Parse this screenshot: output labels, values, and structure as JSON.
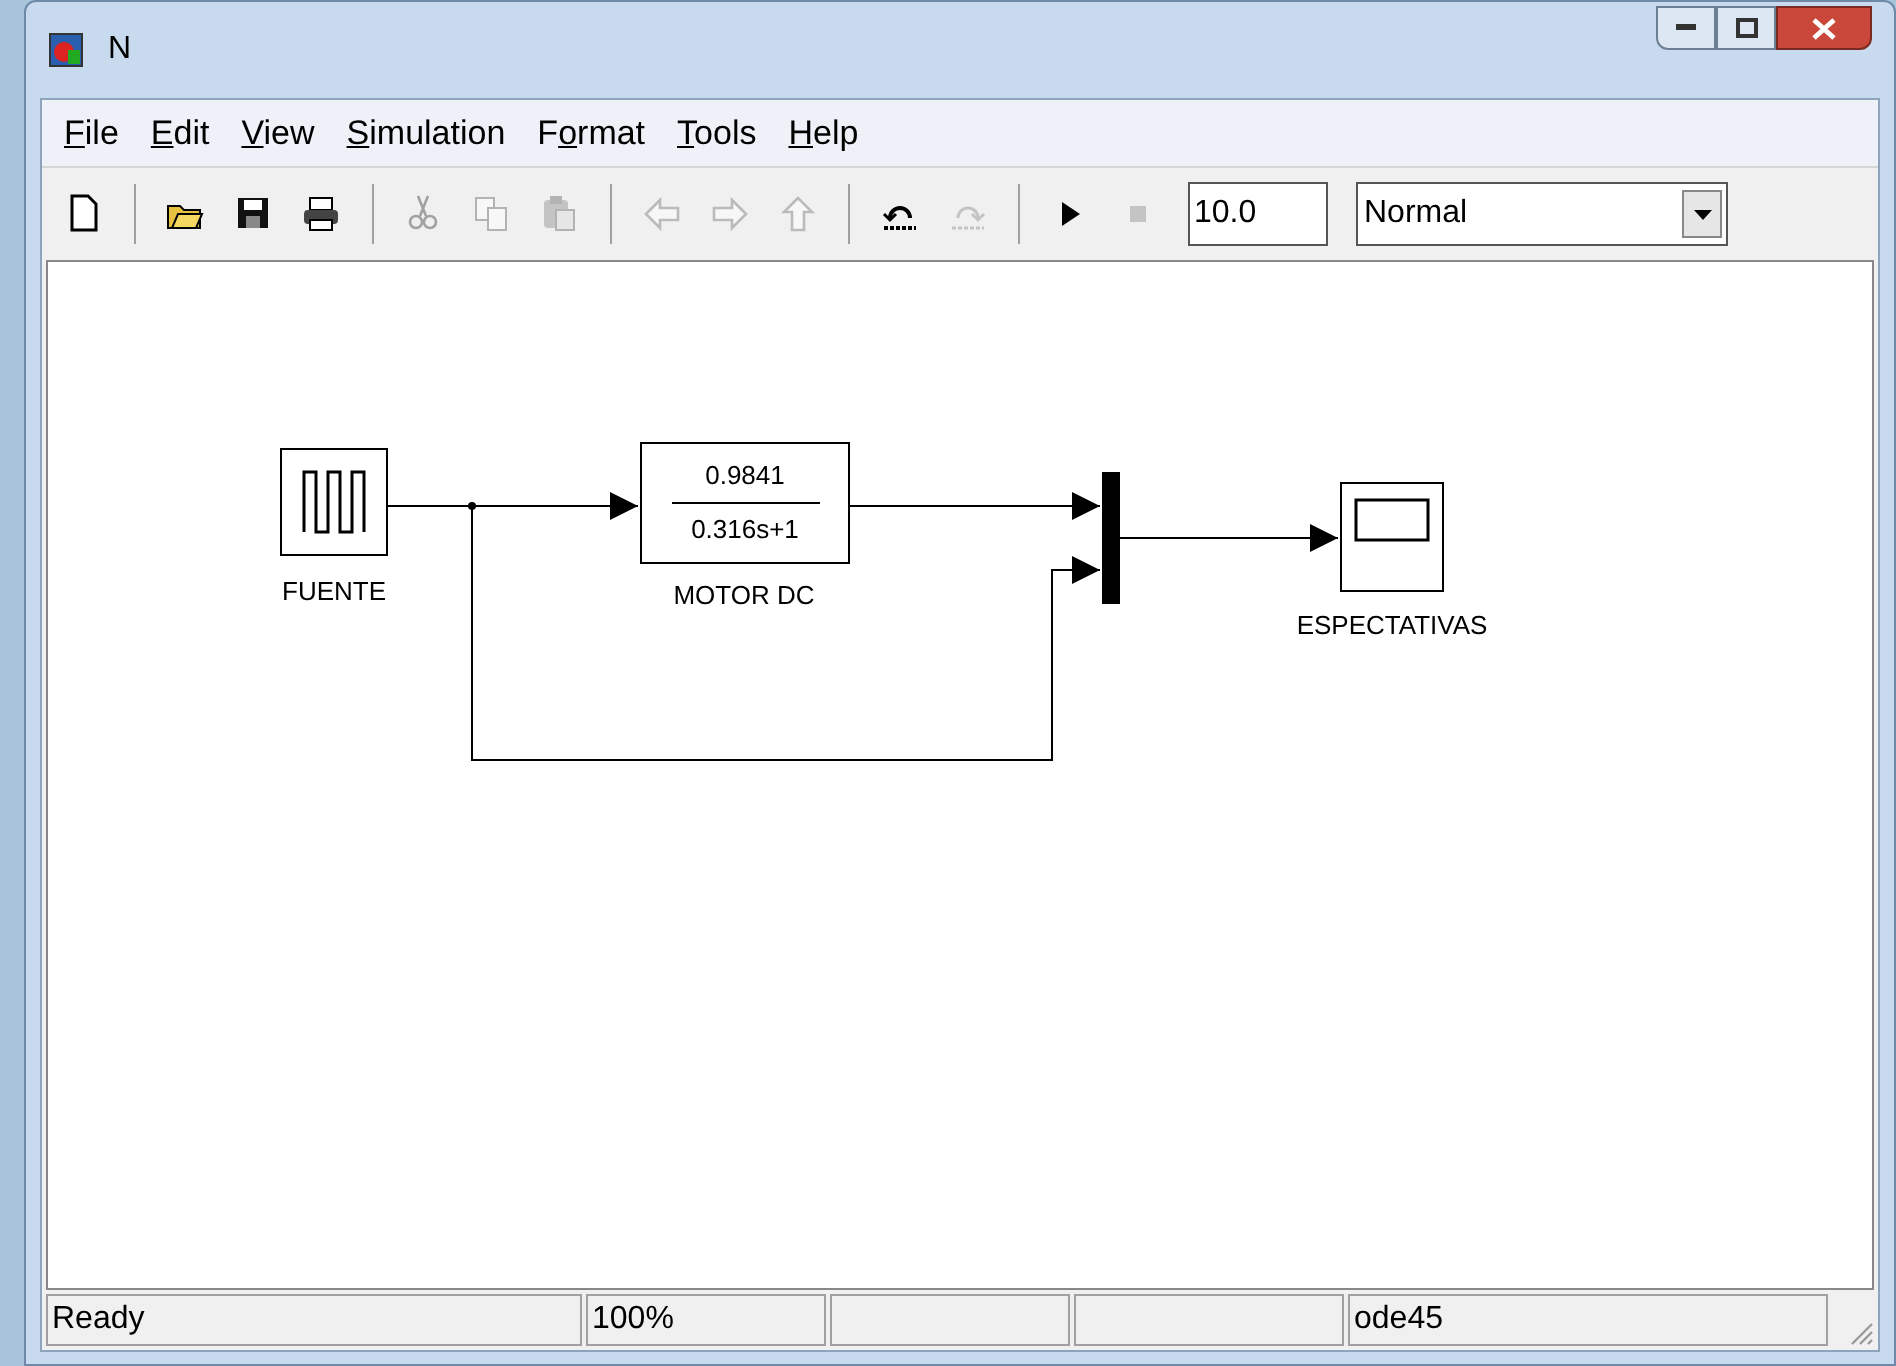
{
  "window": {
    "title": "N"
  },
  "menu": [
    {
      "key": "F",
      "post": "ile"
    },
    {
      "key": "E",
      "post": "dit"
    },
    {
      "key": "V",
      "post": "iew"
    },
    {
      "key": "S",
      "post": "imulation"
    },
    {
      "pre": "F",
      "key": "o",
      "post": "rmat"
    },
    {
      "key": "T",
      "post": "ools"
    },
    {
      "key": "H",
      "post": "elp"
    }
  ],
  "toolbar": [
    {
      "kind": "new",
      "disabled": false
    },
    {
      "kind": "sep"
    },
    {
      "kind": "open",
      "disabled": false
    },
    {
      "kind": "save",
      "disabled": false
    },
    {
      "kind": "print",
      "disabled": false
    },
    {
      "kind": "sep"
    },
    {
      "kind": "cut",
      "disabled": true
    },
    {
      "kind": "copy",
      "disabled": true
    },
    {
      "kind": "paste",
      "disabled": true
    },
    {
      "kind": "sep"
    },
    {
      "kind": "back",
      "disabled": true
    },
    {
      "kind": "forward",
      "disabled": true
    },
    {
      "kind": "up",
      "disabled": true
    },
    {
      "kind": "sep"
    },
    {
      "kind": "undo",
      "disabled": false
    },
    {
      "kind": "redo",
      "disabled": true
    },
    {
      "kind": "sep"
    },
    {
      "kind": "play",
      "disabled": false
    },
    {
      "kind": "stop",
      "disabled": true
    }
  ],
  "stop_time": {
    "value": "10.0"
  },
  "sim_mode": {
    "value": "Normal"
  },
  "blocks": [
    {
      "kind": "pulse",
      "label": "FUENTE"
    },
    {
      "kind": "transfer",
      "label": "MOTOR DC",
      "numerator": "0.9841",
      "denominator": "0.316s+1"
    },
    {
      "kind": "mux"
    },
    {
      "kind": "scope",
      "label": "ESPECTATIVAS"
    }
  ],
  "status_bar": [
    {
      "kind": "text",
      "text": "Ready"
    },
    {
      "kind": "text",
      "text": "100%"
    },
    {
      "kind": "blank"
    },
    {
      "kind": "blank"
    },
    {
      "kind": "text",
      "text": "ode45"
    }
  ]
}
